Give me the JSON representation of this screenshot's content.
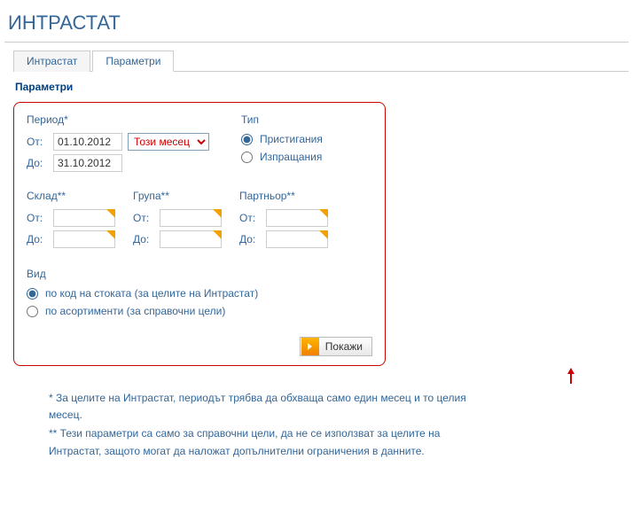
{
  "pageTitle": "ИНТРАСТАТ",
  "tabs": {
    "intrastat": "Интрастат",
    "params": "Параметри"
  },
  "sectionHeader": "Параметри",
  "period": {
    "header": "Период*",
    "from": "От:",
    "to": "До:",
    "fromValue": "01.10.2012",
    "toValue": "31.10.2012",
    "preset": "Този месец"
  },
  "type": {
    "header": "Тип",
    "arrivals": "Пристигания",
    "dispatches": "Изпращания"
  },
  "warehouse": {
    "header": "Склад**",
    "from": "От:",
    "to": "До:"
  },
  "group": {
    "header": "Група**",
    "from": "От:",
    "to": "До:"
  },
  "partner": {
    "header": "Партньор**",
    "from": "От:",
    "to": "До:"
  },
  "kind": {
    "header": "Вид",
    "byCode": "по код на стоката (за целите на Интрастат)",
    "byAssort": "по асортименти (за справочни цели)"
  },
  "showBtn": "Покажи",
  "footnote1": "* За целите на Интрастат, периодът трябва да обхваща само един месец и то целия месец.",
  "footnote2": "** Тези параметри са само за справочни цели, да не се използват за целите на Интрастат, защото могат да наложат допълнителни ограничения в данните."
}
